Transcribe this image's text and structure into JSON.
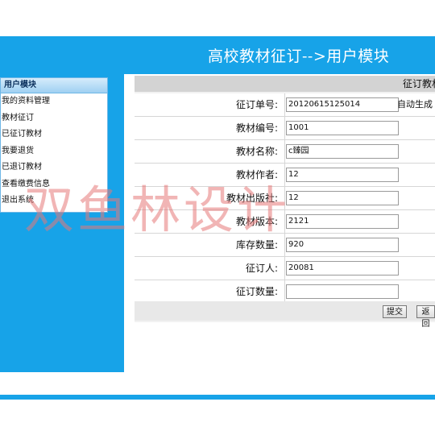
{
  "header": {
    "title": "高校教材征订-->用户模块"
  },
  "sidebar": {
    "heading": "用户模块",
    "items": [
      "我的资料管理",
      "教材征订",
      "已征订教材",
      "我要退货",
      "已退订教材",
      "查看缴费信息",
      "退出系统"
    ]
  },
  "panel": {
    "title": "征订教材"
  },
  "form": {
    "rows": [
      {
        "label": "征订单号:",
        "value": "20120615125014",
        "note": "自动生成"
      },
      {
        "label": "教材编号:",
        "value": "1001"
      },
      {
        "label": "教材名称:",
        "value": "c臻园"
      },
      {
        "label": "教材作者:",
        "value": "12"
      },
      {
        "label": "教材出版社:",
        "value": "12"
      },
      {
        "label": "教材版本:",
        "value": "2121"
      },
      {
        "label": "库存数量:",
        "value": "920"
      },
      {
        "label": "征订人:",
        "value": "20081"
      },
      {
        "label": "征订数量:",
        "value": ""
      }
    ],
    "submit_label": "提交",
    "back_label": "返回"
  },
  "watermark": {
    "text": "双鱼林设计"
  },
  "colors": {
    "accent": "#17a3e8",
    "panel_header": "#d3d3d3"
  }
}
